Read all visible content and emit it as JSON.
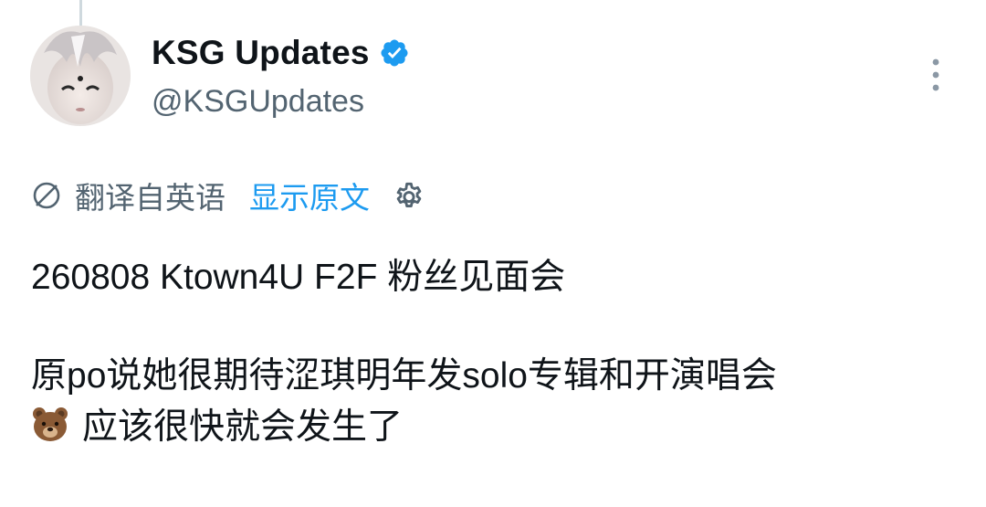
{
  "author": {
    "display_name": "KSG Updates",
    "handle": "@KSGUpdates",
    "verified": true
  },
  "translation": {
    "label": "翻译自英语",
    "show_original": "显示原文"
  },
  "tweet": {
    "line1": "260808 Ktown4U F2F 粉丝见面会",
    "line2": "原po说她很期待涩琪明年发solo专辑和开演唱会",
    "line3": "应该很快就会发生了",
    "emoji": "bear-face"
  },
  "icons": {
    "verified": "verified-badge-icon",
    "more": "more-vertical-icon",
    "translate": "translate-globe-icon",
    "settings": "gear-icon"
  },
  "colors": {
    "accent": "#1d9bf0",
    "secondary_text": "#536471",
    "primary_text": "#0f1419"
  }
}
